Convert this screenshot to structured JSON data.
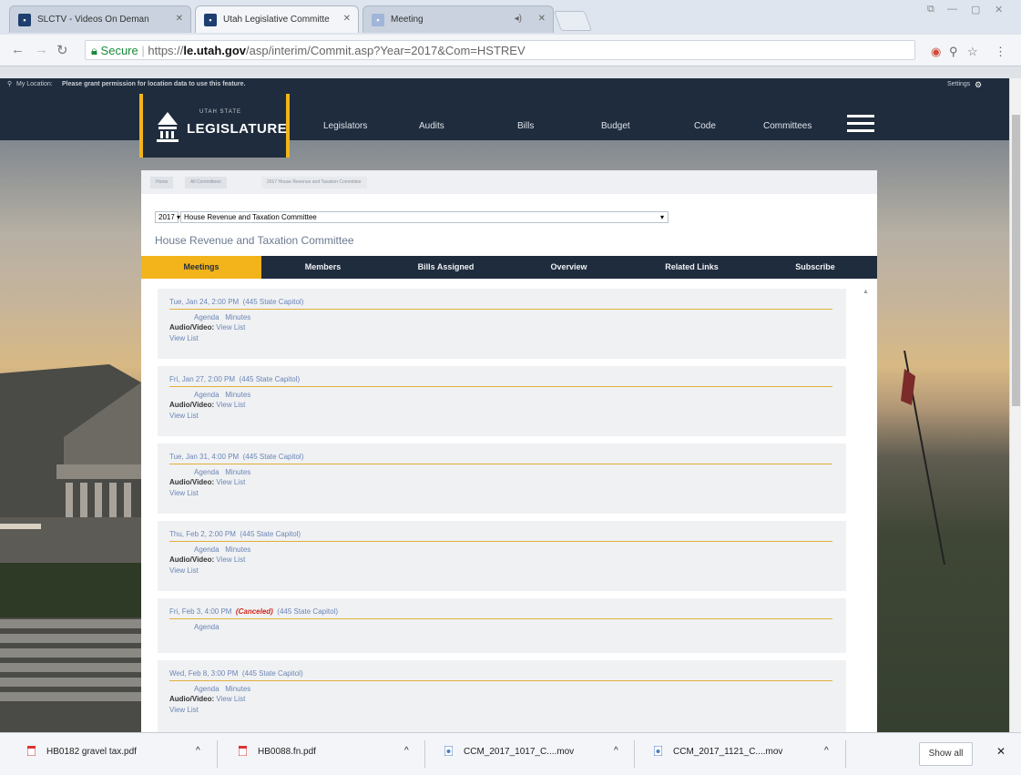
{
  "browser": {
    "tabs": [
      {
        "title": "SLCTV - Videos On Deman"
      },
      {
        "title": "Utah Legislative Committe"
      },
      {
        "title": "Meeting"
      }
    ],
    "url": {
      "secure_label": "Secure",
      "scheme": "https://",
      "host": "le.utah.gov",
      "path": "/asp/interim/Commit.asp?Year=2017&Com=HSTREV"
    }
  },
  "site": {
    "location_notice": {
      "prefix": "My Location:",
      "text": "Please grant permission for location data to use this feature."
    },
    "settings_label": "Settings",
    "logo": {
      "small": "UTAH STATE",
      "big": "LEGISLATURE"
    },
    "nav": [
      "Legislators",
      "Audits",
      "Bills",
      "Budget",
      "Code",
      "Committees"
    ]
  },
  "committee": {
    "breadcrumb": [
      "Home",
      "All Committees",
      "2017 House Revenue and Taxation Committee"
    ],
    "year": "2017",
    "committee_select": "House Revenue and Taxation Committee",
    "title": "House Revenue and Taxation Committee",
    "tabs": [
      "Meetings",
      "Members",
      "Bills Assigned",
      "Overview",
      "Related Links",
      "Subscribe"
    ]
  },
  "meetings": [
    {
      "date": "Tue, Jan 24, 2:00 PM",
      "location": "(445 State Capitol)",
      "agenda": "Agenda",
      "minutes": "Minutes",
      "av_label": "Audio/Video:",
      "av_link": "View List",
      "extra": "View List"
    },
    {
      "date": "Fri, Jan 27, 2:00 PM",
      "location": "(445 State Capitol)",
      "agenda": "Agenda",
      "minutes": "Minutes",
      "av_label": "Audio/Video:",
      "av_link": "View List",
      "extra": "View List"
    },
    {
      "date": "Tue, Jan 31, 4:00 PM",
      "location": "(445 State Capitol)",
      "agenda": "Agenda",
      "minutes": "Minutes",
      "av_label": "Audio/Video:",
      "av_link": "View List",
      "extra": "View List"
    },
    {
      "date": "Thu, Feb 2, 2:00 PM",
      "location": "(445 State Capitol)",
      "agenda": "Agenda",
      "minutes": "Minutes",
      "av_label": "Audio/Video:",
      "av_link": "View List",
      "extra": "View List"
    },
    {
      "date": "Fri, Feb 3, 4:00 PM",
      "canceled": "(Canceled)",
      "location": "(445 State Capitol)",
      "agenda": "Agenda"
    },
    {
      "date": "Wed, Feb 8, 3:00 PM",
      "location": "(445 State Capitol)",
      "agenda": "Agenda",
      "minutes": "Minutes",
      "av_label": "Audio/Video:",
      "av_link": "View List",
      "extra": "View List"
    }
  ],
  "downloads": {
    "items": [
      {
        "name": "HB0182 gravel tax.pdf"
      },
      {
        "name": "HB0088.fn.pdf"
      },
      {
        "name": "CCM_2017_1017_C....mov"
      },
      {
        "name": "CCM_2017_1121_C....mov"
      }
    ],
    "show_all": "Show all"
  },
  "colors": {
    "navy": "#1f2c3d",
    "gold": "#f2b31b",
    "link": "#6b86b6",
    "canceled": "#d0271d"
  }
}
